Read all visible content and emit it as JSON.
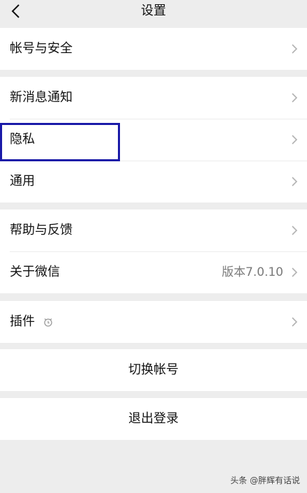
{
  "header": {
    "title": "设置"
  },
  "groups": [
    {
      "items": [
        {
          "label": "帐号与安全"
        }
      ]
    },
    {
      "items": [
        {
          "label": "新消息通知"
        },
        {
          "label": "隐私"
        },
        {
          "label": "通用"
        }
      ]
    },
    {
      "items": [
        {
          "label": "帮助与反馈"
        },
        {
          "label": "关于微信",
          "value": "版本7.0.10"
        }
      ]
    },
    {
      "items": [
        {
          "label": "插件"
        }
      ]
    }
  ],
  "actions": {
    "switch_account": "切换帐号",
    "logout": "退出登录"
  },
  "watermark": "头条 @胖辉有话说",
  "colors": {
    "background": "#ededed",
    "highlight_border": "#1a1aa8"
  }
}
